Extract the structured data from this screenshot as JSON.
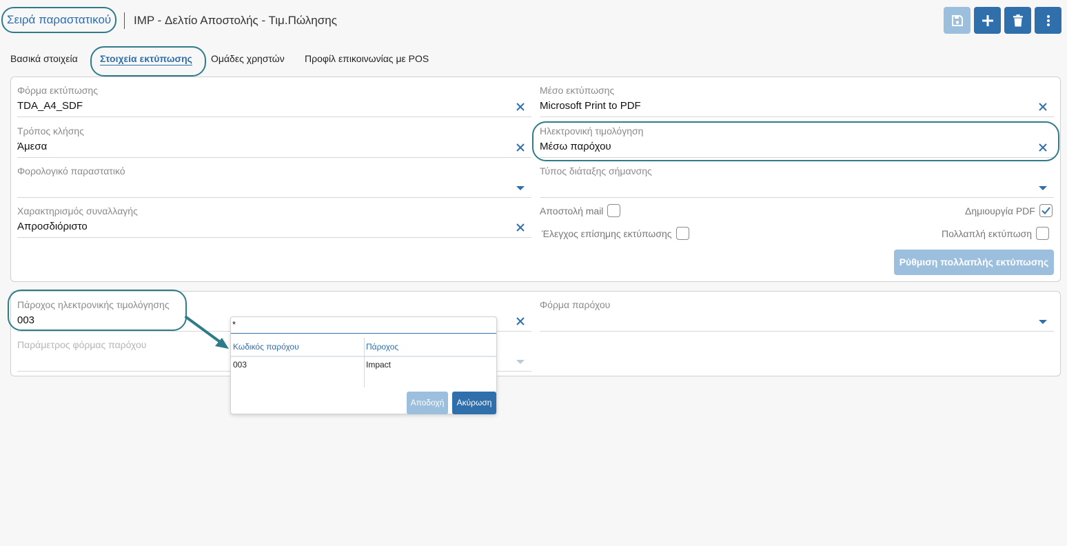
{
  "header": {
    "breadcrumb": "Σειρά παραστατικού",
    "title": "IMP - Δελτίο Αποστολής - Τιμ.Πώλησης"
  },
  "toolbar": {
    "save_icon": "save-icon",
    "add_icon": "plus-icon",
    "delete_icon": "trash-icon",
    "more_icon": "more-vertical-icon"
  },
  "tabs": [
    {
      "label": "Βασικά στοιχεία",
      "active": false
    },
    {
      "label": "Στοιχεία εκτύπωσης",
      "active": true
    },
    {
      "label": "Ομάδες χρηστών",
      "active": false
    },
    {
      "label": "Προφίλ επικοινωνίας με POS",
      "active": false
    }
  ],
  "print_panel": {
    "left": [
      {
        "label": "Φόρμα εκτύπωσης",
        "value": "TDA_A4_SDF",
        "control": "clear"
      },
      {
        "label": "Τρόπος κλήσης",
        "value": "Άμεσα",
        "control": "clear"
      },
      {
        "label": "Φορολογικό παραστατικό",
        "value": "",
        "control": "dropdown"
      },
      {
        "label": "Χαρακτηρισμός συναλλαγής",
        "value": "Απροσδιόριστο",
        "control": "clear"
      }
    ],
    "right": [
      {
        "label": "Μέσο εκτύπωσης",
        "value": "Microsoft Print to PDF",
        "control": "clear"
      },
      {
        "label": "Ηλεκτρονική τιμολόγηση",
        "value": "Μέσω παρόχου",
        "control": "clear"
      },
      {
        "label": "Τύπος διάταξης σήμανσης",
        "value": "",
        "control": "dropdown"
      }
    ],
    "checks": {
      "send_mail": {
        "label": "Αποστολή mail",
        "checked": false
      },
      "create_pdf": {
        "label": "Δημιουργία PDF",
        "checked": true
      },
      "official_print_check": {
        "label": "Έλεγχος επίσημης εκτύπωσης",
        "checked": false
      },
      "multiple_print": {
        "label": "Πολλαπλή εκτύπωση",
        "checked": false
      }
    },
    "multi_print_button": "Ρύθμιση πολλαπλής εκτύπωσης"
  },
  "provider_panel": {
    "provider_field": {
      "label": "Πάροχος ηλεκτρονικής τιμολόγησης",
      "value": "003"
    },
    "provider_param_field": {
      "label": "Παράμετρος φόρμας παρόχου",
      "value": ""
    },
    "provider_form_field": {
      "label": "Φόρμα παρόχου",
      "value": ""
    }
  },
  "lookup_popup": {
    "search_value": "*",
    "columns": [
      "Κωδικός παρόχου",
      "Πάροχος"
    ],
    "rows": [
      [
        "003",
        "Impact"
      ]
    ],
    "accept_label": "Αποδοχή",
    "cancel_label": "Ακύρωση"
  },
  "colors": {
    "accent": "#2f6fab",
    "accent_disabled": "#9dbfde",
    "highlight_ring": "#2e7b8a"
  }
}
